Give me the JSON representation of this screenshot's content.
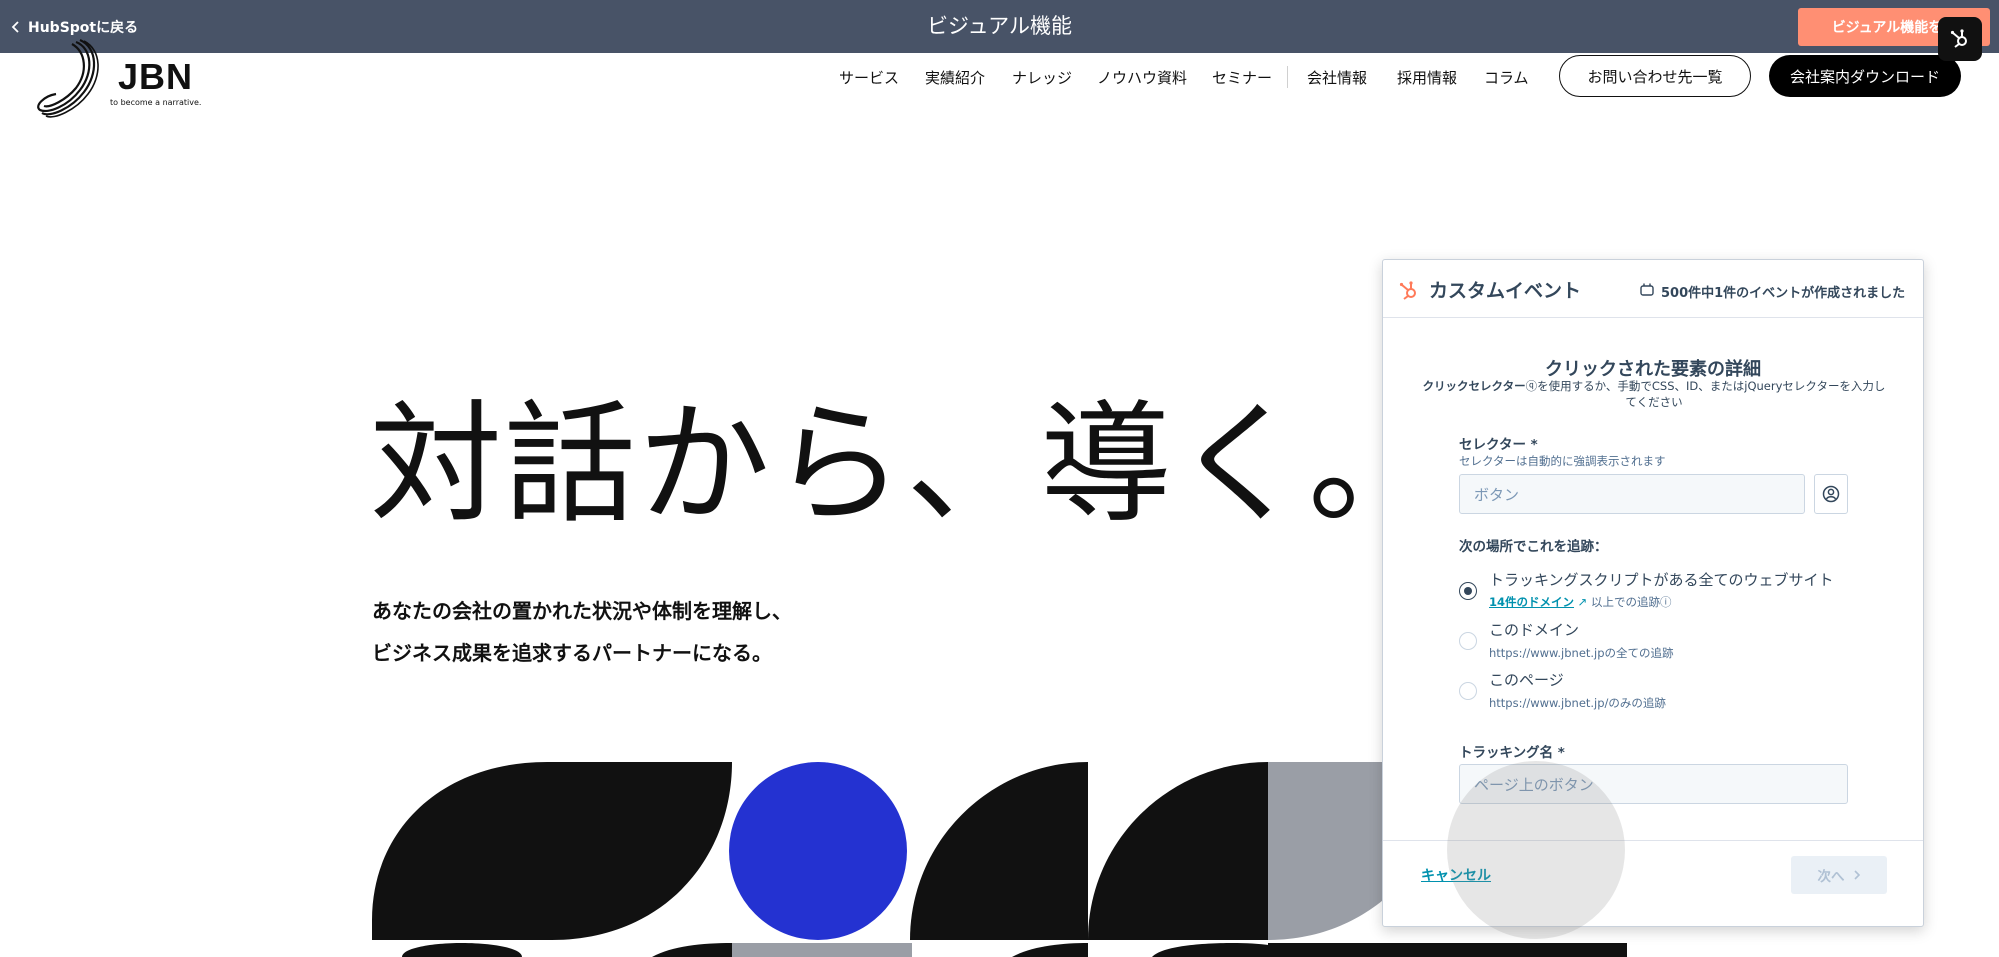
{
  "hubspot_bar": {
    "back_label": "HubSpotに戻る",
    "title": "ビジュアル機能",
    "open_button": "ビジュアル機能を閉"
  },
  "site": {
    "logo_text": "JBN",
    "logo_tagline": "to become a narrative.",
    "nav": [
      "サービス",
      "実績紹介",
      "ナレッジ",
      "ノウハウ資料",
      "セミナー",
      "会社情報",
      "採用情報",
      "コラム"
    ],
    "contact_button": "お問い合わせ先一覧",
    "download_button": "会社案内ダウンロード"
  },
  "hero": {
    "title": "対話から、導く。",
    "subtitle_line1": "あなたの会社の置かれた状況や体制を理解し、",
    "subtitle_line2": "ビジネス成果を追求するパートナーになる。"
  },
  "panel": {
    "title": "カスタムイベント",
    "count": "500件中1件のイベントが作成されました",
    "section_title": "クリックされた要素の詳細",
    "section_desc_bold": "クリックセレクター",
    "section_desc_rest": "を使用するか、手動でCSS、ID、またはjQueryセレクターを入力してください",
    "selector_label": "セレクター *",
    "selector_help": "セレクターは自動的に強調表示されます",
    "selector_placeholder": "ボタン",
    "track_label": "次の場所でこれを追跡：",
    "options": [
      {
        "label": "トラッキングスクリプトがある全てのウェブサイト",
        "link": "14件のドメイン",
        "sub": "以上での追跡",
        "selected": true
      },
      {
        "label": "このドメイン",
        "sub": "https://www.jbnet.jpの全ての追跡",
        "selected": false
      },
      {
        "label": "このページ",
        "sub": "https://www.jbnet.jp/のみの追跡",
        "selected": false
      }
    ],
    "tracking_name_label": "トラッキング名 *",
    "tracking_name_placeholder": "ページ上のボタン",
    "cancel_label": "キャンセル",
    "next_label": "次へ"
  },
  "colors": {
    "hubspot_bar": "#485367",
    "open_button": "#ff8f73",
    "hubspot_orange": "#ff7a59",
    "link": "#0091ae",
    "shape_blue": "#2432d1",
    "shape_gray": "#9a9ea6"
  }
}
